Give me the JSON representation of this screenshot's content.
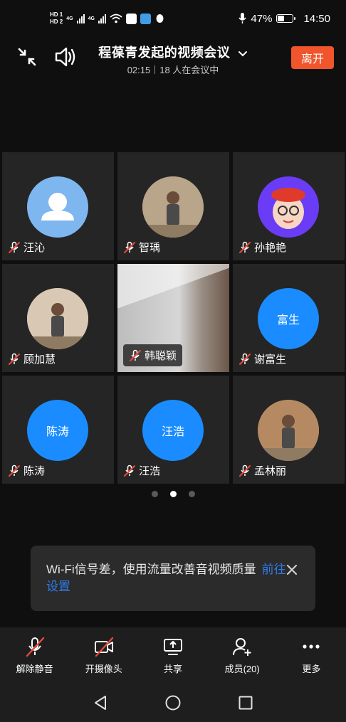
{
  "status_bar": {
    "hd1": "HD 1",
    "hd2": "HD 2",
    "net1": "4G",
    "net2": "4G",
    "battery_percent": "47%",
    "battery_level": 0.47,
    "time": "14:50"
  },
  "header": {
    "title": "程葆青发起的视频会议",
    "duration": "02:15",
    "participants_in_meeting": "18 人在会议中",
    "leave_label": "离开"
  },
  "participants": [
    {
      "name": "汪沁",
      "avatar_type": "default-person",
      "avatar_color": "#7eb6ef",
      "muted": true
    },
    {
      "name": "智瑀",
      "avatar_type": "photo",
      "avatar_color": "#b9a58a",
      "muted": true
    },
    {
      "name": "孙艳艳",
      "avatar_type": "cartoon",
      "avatar_color": "#6b3cf5",
      "muted": true
    },
    {
      "name": "顾加慧",
      "avatar_type": "photo",
      "avatar_color": "#d9c9b4",
      "muted": true
    },
    {
      "name": "韩聪颖",
      "avatar_type": "video",
      "avatar_color": "#cfcfcf",
      "muted": true
    },
    {
      "name": "谢富生",
      "avatar_type": "text",
      "avatar_text": "富生",
      "avatar_color": "#1a8cff",
      "muted": true
    },
    {
      "name": "陈涛",
      "avatar_type": "text",
      "avatar_text": "陈涛",
      "avatar_color": "#1a8cff",
      "muted": true
    },
    {
      "name": "汪浩",
      "avatar_type": "text",
      "avatar_text": "汪浩",
      "avatar_color": "#1a8cff",
      "muted": true
    },
    {
      "name": "孟林丽",
      "avatar_type": "photo",
      "avatar_color": "#b58a63",
      "muted": true
    }
  ],
  "pager": {
    "pages": 3,
    "active": 2
  },
  "toast": {
    "message": "Wi-Fi信号差，使用流量改善音视频质量",
    "link": "前往设置"
  },
  "toolbar": {
    "unmute": "解除静音",
    "camera": "开摄像头",
    "share": "共享",
    "members": "成员(20)",
    "more": "更多"
  },
  "colors": {
    "background": "#0f0f0f",
    "tile": "#252525",
    "accent_blue": "#1a8cff",
    "leave_button": "#f0552c",
    "mute_red": "#e84a3b",
    "link": "#2f7be8"
  }
}
